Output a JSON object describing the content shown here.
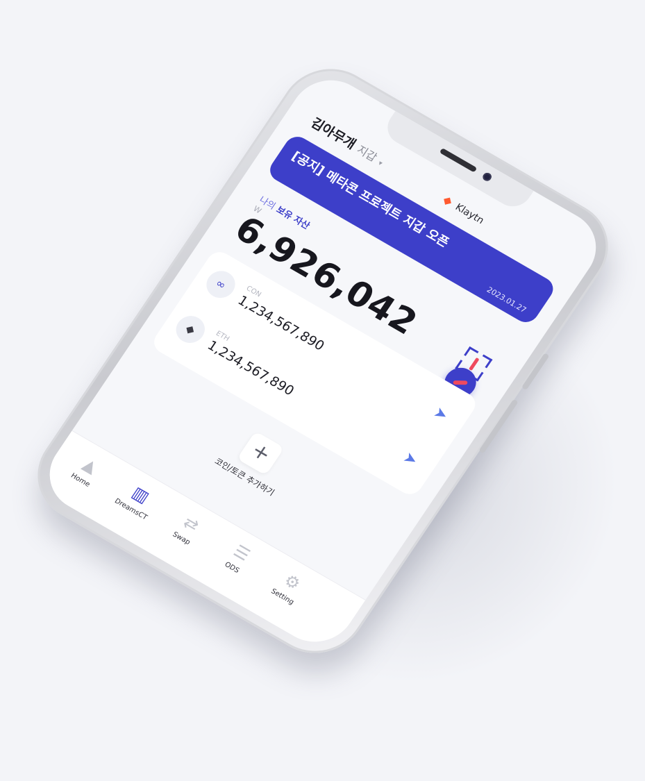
{
  "header": {
    "wallet_name": "김아무개",
    "wallet_suffix": "지갑",
    "chevron": "chevron-down-icon",
    "brand": "Klaytn"
  },
  "notice": {
    "text": "[공지] 메타콘 프로젝트 지갑 오픈",
    "date": "2023.01.27"
  },
  "assets": {
    "label_prefix": "나의",
    "label_main": "보유 자산",
    "currency": "W",
    "total": "6,926,042"
  },
  "coins": [
    {
      "symbol": "CON",
      "balance": "1,234,567,890",
      "icon": "con-coin-icon"
    },
    {
      "symbol": "ETH",
      "balance": "1,234,567,890",
      "icon": "eth-coin-icon"
    }
  ],
  "add_coin": {
    "label": "코인/토큰 추가하기"
  },
  "tabs": [
    {
      "label": "Home",
      "icon": "home-icon"
    },
    {
      "label": "DreamsCT",
      "icon": "city-icon"
    },
    {
      "label": "Swap",
      "icon": "swap-icon"
    },
    {
      "label": "ODS",
      "icon": "ods-icon"
    },
    {
      "label": "Setting",
      "icon": "gear-icon"
    }
  ],
  "colors": {
    "accent": "#3d3fc9",
    "accent_red": "#ef4a5e",
    "send_blue": "#5b79e6"
  }
}
